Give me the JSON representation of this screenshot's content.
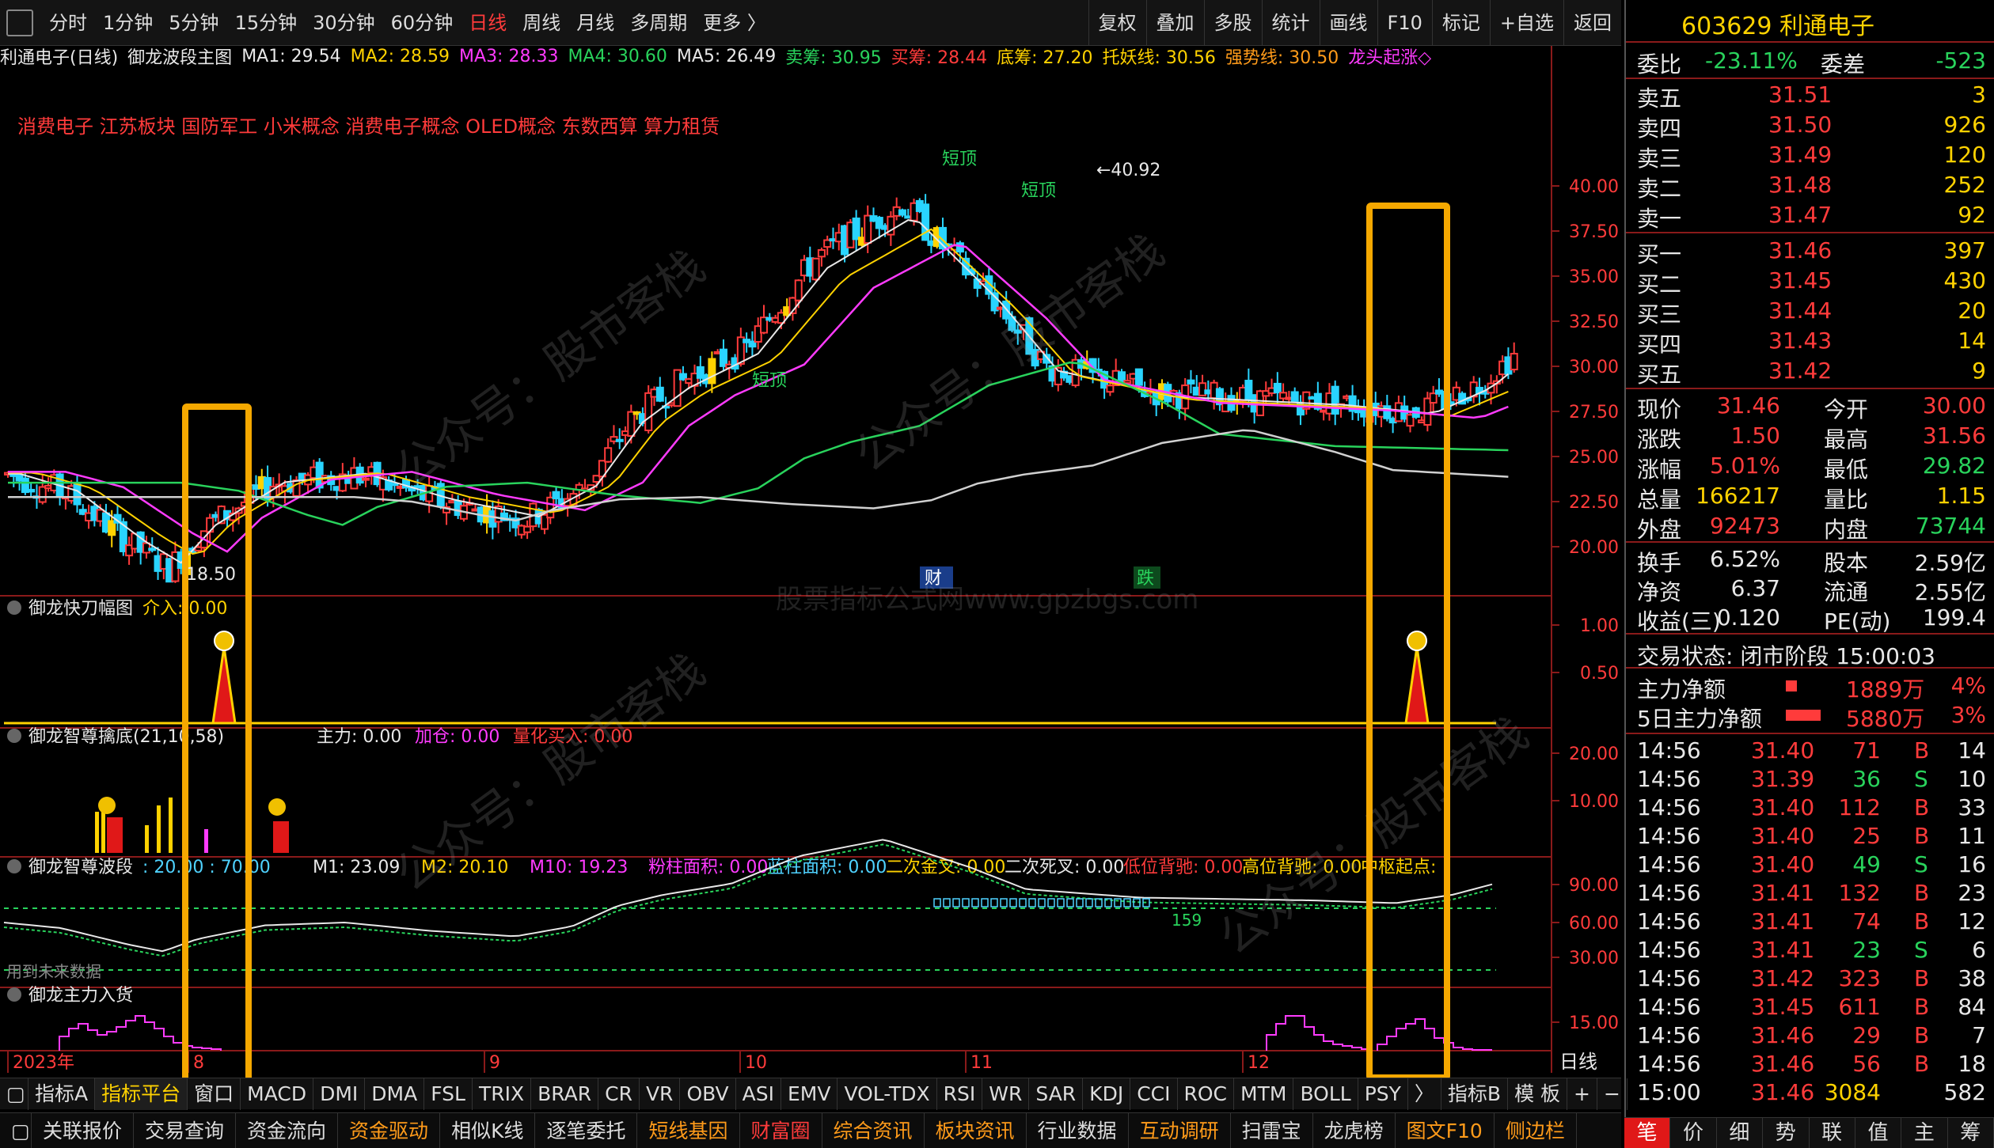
{
  "topbar": {
    "periods": [
      "分时",
      "1分钟",
      "5分钟",
      "15分钟",
      "30分钟",
      "60分钟",
      "日线",
      "周线",
      "月线",
      "多周期",
      "更多 〉"
    ],
    "active_period": "日线",
    "tools": [
      "复权",
      "叠加",
      "多股",
      "统计",
      "画线",
      "F10",
      "标记",
      "+自选",
      "返回"
    ]
  },
  "indicator_line": {
    "stock": "利通电子(日线)",
    "formula": "御龙波段主图",
    "items": [
      {
        "t": "MA1: 29.54",
        "c": "#e8e8e8"
      },
      {
        "t": "MA2: 28.59",
        "c": "#ffd200"
      },
      {
        "t": "MA3: 28.33",
        "c": "#ff3bff"
      },
      {
        "t": "MA4: 30.60",
        "c": "#29d35c"
      },
      {
        "t": "MA5: 26.49",
        "c": "#e8e8e8"
      },
      {
        "t": "卖筹: 30.95",
        "c": "#29d35c"
      },
      {
        "t": "买筹: 28.44",
        "c": "#ff3b3b"
      },
      {
        "t": "底筹: 27.20",
        "c": "#ffd200"
      },
      {
        "t": "托妖线: 30.56",
        "c": "#ffd200"
      },
      {
        "t": "强势线: 30.50",
        "c": "#ff9b1a"
      },
      {
        "t": "龙头起涨◇",
        "c": "#ff3bff"
      }
    ]
  },
  "concepts": "消费电子 江苏板块 国防军工 小米概念 消费电子概念 OLED概念 东数西算 算力租赁",
  "price_axis": [
    "40.00",
    "37.50",
    "35.00",
    "32.50",
    "30.00",
    "27.50",
    "25.00",
    "22.50",
    "20.00"
  ],
  "price_labels": {
    "high": "40.92",
    "low": "18.50"
  },
  "chart_marks": {
    "short_top1": "短顶",
    "short_top2": "短顶",
    "short_top3": "短顶",
    "short_bottom": "短顶",
    "fin": "财",
    "down": "跌"
  },
  "panels": {
    "p1": {
      "title": "御龙快刀幅图",
      "items": [
        {
          "t": "介入: 0.00",
          "c": "#ffd200"
        }
      ],
      "axis": [
        "1.00",
        "0.50"
      ]
    },
    "p2": {
      "title": "御龙智尊擒底(21,10,58)",
      "items": [
        {
          "t": "主力: 0.00",
          "c": "#e8e8e8"
        },
        {
          "t": "加仓: 0.00",
          "c": "#ff3bff"
        },
        {
          "t": "量化买入: 0.00",
          "c": "#ff3b3b"
        }
      ],
      "axis": [
        "20.00",
        "10.00"
      ]
    },
    "p3": {
      "title": "御龙智尊波段",
      "items": [
        {
          "t": ": 20.00 : 70.00",
          "c": "#4fd2ff"
        },
        {
          "t": "M1: 23.09",
          "c": "#e8e8e8"
        },
        {
          "t": "M2: 20.10",
          "c": "#ffd200"
        },
        {
          "t": "M10: 19.23",
          "c": "#ff3bff"
        },
        {
          "t": "粉柱面积: 0.00",
          "c": "#ff3bff"
        },
        {
          "t": "蓝柱面积: 0.00",
          "c": "#4fd2ff"
        },
        {
          "t": "二次金叉: 0.00",
          "c": "#ffd200"
        },
        {
          "t": "二次死叉: 0.00",
          "c": "#e8e8e8"
        },
        {
          "t": "低位背驰: 0.00",
          "c": "#ff3b3b"
        },
        {
          "t": "高位背驰: 0.00",
          "c": "#ffd200"
        },
        {
          "t": "中枢起点:",
          "c": "#ffd200"
        }
      ],
      "axis": [
        "90.00",
        "60.00",
        "30.00"
      ],
      "mark": "159",
      "bottom_text": "用到未来数据"
    },
    "p4": {
      "title": "御龙主力入货",
      "axis": [
        "15.00"
      ]
    }
  },
  "date_axis": {
    "labels": [
      "2023年",
      "8",
      "9",
      "10",
      "11",
      "12"
    ],
    "mode": "日线"
  },
  "bottom_tabs": [
    "指标A",
    "指标平台",
    "窗口",
    "MACD",
    "DMI",
    "DMA",
    "FSL",
    "TRIX",
    "BRAR",
    "CR",
    "VR",
    "OBV",
    "ASI",
    "EMV",
    "VOL-TDX",
    "RSI",
    "WR",
    "SAR",
    "KDJ",
    "CCI",
    "ROC",
    "MTM",
    "BOLL",
    "PSY",
    "〉"
  ],
  "bottom_tabs_right": [
    "指标B",
    "模 板",
    "+",
    "−"
  ],
  "func_bar": [
    {
      "t": "关联报价",
      "c": ""
    },
    {
      "t": "交易查询",
      "c": ""
    },
    {
      "t": "资金流向",
      "c": ""
    },
    {
      "t": "资金驱动",
      "c": "orange"
    },
    {
      "t": "相似K线",
      "c": ""
    },
    {
      "t": "逐笔委托",
      "c": ""
    },
    {
      "t": "短线基因",
      "c": "orange"
    },
    {
      "t": "财富圈",
      "c": "red"
    },
    {
      "t": "综合资讯",
      "c": "orange"
    },
    {
      "t": "板块资讯",
      "c": "orange"
    },
    {
      "t": "行业数据",
      "c": ""
    },
    {
      "t": "互动调研",
      "c": "orange"
    },
    {
      "t": "扫雷宝",
      "c": ""
    },
    {
      "t": "龙虎榜",
      "c": ""
    },
    {
      "t": "图文F10",
      "c": "orange"
    },
    {
      "t": "侧边栏",
      "c": "orange"
    }
  ],
  "right_tabs": [
    "笔",
    "价",
    "细",
    "势",
    "联",
    "值",
    "主",
    "筹"
  ],
  "quote": {
    "header": "603629 利通电子",
    "weibi": {
      "label": "委比",
      "value": "-23.11%",
      "label2": "委差",
      "value2": "-523"
    },
    "asks": [
      {
        "label": "卖五",
        "price": "31.51",
        "vol": "3"
      },
      {
        "label": "卖四",
        "price": "31.50",
        "vol": "926"
      },
      {
        "label": "卖三",
        "price": "31.49",
        "vol": "120"
      },
      {
        "label": "卖二",
        "price": "31.48",
        "vol": "252"
      },
      {
        "label": "卖一",
        "price": "31.47",
        "vol": "92"
      }
    ],
    "bids": [
      {
        "label": "买一",
        "price": "31.46",
        "vol": "397"
      },
      {
        "label": "买二",
        "price": "31.45",
        "vol": "430"
      },
      {
        "label": "买三",
        "price": "31.44",
        "vol": "20"
      },
      {
        "label": "买四",
        "price": "31.43",
        "vol": "14"
      },
      {
        "label": "买五",
        "price": "31.42",
        "vol": "9"
      }
    ],
    "stats": [
      {
        "l1": "现价",
        "v1": "31.46",
        "c1": "red",
        "l2": "今开",
        "v2": "30.00",
        "c2": "red"
      },
      {
        "l1": "涨跌",
        "v1": "1.50",
        "c1": "red",
        "l2": "最高",
        "v2": "31.56",
        "c2": "red"
      },
      {
        "l1": "涨幅",
        "v1": "5.01%",
        "c1": "red",
        "l2": "最低",
        "v2": "29.82",
        "c2": "green"
      },
      {
        "l1": "总量",
        "v1": "166217",
        "c1": "yellow",
        "l2": "量比",
        "v2": "1.15",
        "c2": "yellow"
      },
      {
        "l1": "外盘",
        "v1": "92473",
        "c1": "red",
        "l2": "内盘",
        "v2": "73744",
        "c2": "green"
      }
    ],
    "fin": [
      {
        "l1": "换手",
        "v1": "6.52%",
        "l2": "股本",
        "v2": "2.59亿"
      },
      {
        "l1": "净资",
        "v1": "6.37",
        "l2": "流通",
        "v2": "2.55亿"
      },
      {
        "l1": "收益(三)",
        "v1": "0.120",
        "l2": "PE(动)",
        "v2": "199.4"
      }
    ],
    "trade_status": "交易状态: 闭市阶段 15:00:03",
    "main_net": {
      "label": "主力净额",
      "value": "1889万",
      "pct": "4%"
    },
    "main_net5": {
      "label": "5日主力净额",
      "value": "5880万",
      "pct": "3%"
    },
    "ticks": [
      {
        "time": "14:56",
        "price": "31.40",
        "vol": "71",
        "bs": "B",
        "n": "14"
      },
      {
        "time": "14:56",
        "price": "31.39",
        "vol": "36",
        "bs": "S",
        "n": "10"
      },
      {
        "time": "14:56",
        "price": "31.40",
        "vol": "112",
        "bs": "B",
        "n": "33"
      },
      {
        "time": "14:56",
        "price": "31.40",
        "vol": "25",
        "bs": "B",
        "n": "11"
      },
      {
        "time": "14:56",
        "price": "31.40",
        "vol": "49",
        "bs": "S",
        "n": "16"
      },
      {
        "time": "14:56",
        "price": "31.41",
        "vol": "132",
        "bs": "B",
        "n": "23"
      },
      {
        "time": "14:56",
        "price": "31.41",
        "vol": "74",
        "bs": "B",
        "n": "12"
      },
      {
        "time": "14:56",
        "price": "31.41",
        "vol": "23",
        "bs": "S",
        "n": "6"
      },
      {
        "time": "14:56",
        "price": "31.42",
        "vol": "323",
        "bs": "B",
        "n": "38"
      },
      {
        "time": "14:56",
        "price": "31.45",
        "vol": "611",
        "bs": "B",
        "n": "84"
      },
      {
        "time": "14:56",
        "price": "31.46",
        "vol": "29",
        "bs": "B",
        "n": "7"
      },
      {
        "time": "14:56",
        "price": "31.46",
        "vol": "56",
        "bs": "B",
        "n": "18"
      },
      {
        "time": "15:00",
        "price": "31.46",
        "vol": "3084",
        "bs": "",
        "n": "582"
      }
    ]
  },
  "chart_data": {
    "type": "candlestick",
    "ylim": [
      17.5,
      42.5
    ],
    "range_note": "2023 daily, Jul to Dec",
    "high": 40.92,
    "low": 18.5
  },
  "colors": {
    "up": "#ff3b3b",
    "down": "#29d4ff",
    "ma1": "#e8e8e8",
    "ma2": "#ffd200",
    "ma3": "#ff3bff",
    "ma4": "#29d35c",
    "ma5": "#d0d0d0",
    "highlight": "#f5a800"
  }
}
